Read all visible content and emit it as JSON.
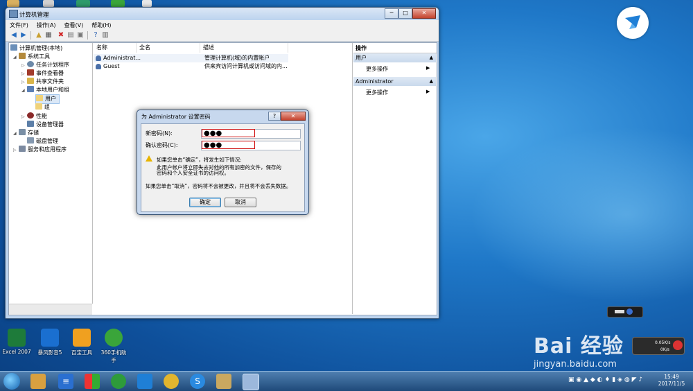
{
  "window": {
    "title": "计算机管理",
    "min": "─",
    "max": "□",
    "close": "✕"
  },
  "menu": [
    "文件(F)",
    "操作(A)",
    "查看(V)",
    "帮助(H)"
  ],
  "tree": [
    {
      "label": "计算机管理(本地)",
      "color": "#6a8fb9",
      "tri": ""
    },
    {
      "label": "系统工具",
      "color": "#b48a3c",
      "tri": "◢"
    },
    {
      "label": "任务计划程序",
      "color": "#6c89a8",
      "tri": "▷"
    },
    {
      "label": "事件查看器",
      "color": "#a23b2b",
      "tri": "▷"
    },
    {
      "label": "共享文件夹",
      "color": "#d9b54a",
      "tri": "▷"
    },
    {
      "label": "本地用户和组",
      "color": "#5a7fb5",
      "tri": "◢"
    },
    {
      "label": "用户",
      "color": "#f0d27a",
      "tri": ""
    },
    {
      "label": "组",
      "color": "#f0d27a",
      "tri": ""
    },
    {
      "label": "性能",
      "color": "#8a2a2a",
      "tri": "▷"
    },
    {
      "label": "设备管理器",
      "color": "#5c7fa8",
      "tri": ""
    },
    {
      "label": "存储",
      "color": "#7a8fa5",
      "tri": "◢"
    },
    {
      "label": "磁盘管理",
      "color": "#8599b0",
      "tri": ""
    },
    {
      "label": "服务和应用程序",
      "color": "#7c8aa0",
      "tri": "▷"
    }
  ],
  "list": {
    "headers": [
      "名称",
      "全名",
      "描述"
    ],
    "rows": [
      {
        "name": "Administrat...",
        "full": "",
        "desc": "管理计算机(域)的内置帐户"
      },
      {
        "name": "Guest",
        "full": "",
        "desc": "供来宾访问计算机或访问域的内..."
      }
    ]
  },
  "actions": {
    "header": "操作",
    "sections": [
      {
        "title": "用户",
        "item": "更多操作"
      },
      {
        "title": "Administrator",
        "item": "更多操作"
      }
    ],
    "collapse": "▲",
    "arrow": "▶"
  },
  "dialog": {
    "title": "为 Administrator 设置密码",
    "help": "?",
    "close": "✕",
    "new_label": "新密码(N):",
    "new_value": "●●●",
    "confirm_label": "确认密码(C):",
    "confirm_value": "●●●",
    "warn_line1": "如果您单击“确定”，将发生如下情况:",
    "warn_line2": "此用户帐户将立即失去对他的所有加密的文件，保存的",
    "warn_line3": "密码和个人安全证书的访问权。",
    "cancel_note": "如果您单击“取消”，密码将不会被更改，并且将不会丢失数据。",
    "ok": "确定",
    "cancel": "取消"
  },
  "desktop_icons": [
    {
      "label": "Excel 2007",
      "color": "#1e7b3a"
    },
    {
      "label": "暴风影音5",
      "color": "#1a6fd0"
    },
    {
      "label": "百宝工具",
      "color": "#f0a020"
    },
    {
      "label": "360手机助手",
      "color": "#3aa53a"
    }
  ],
  "watermark": {
    "big": "Bai 经验",
    "small": "jingyan.baidu.com"
  },
  "netmon": {
    "up": "0.05K/s",
    "down": "0K/s"
  },
  "clock": {
    "time": "15:49",
    "date": "2017/11/5"
  }
}
